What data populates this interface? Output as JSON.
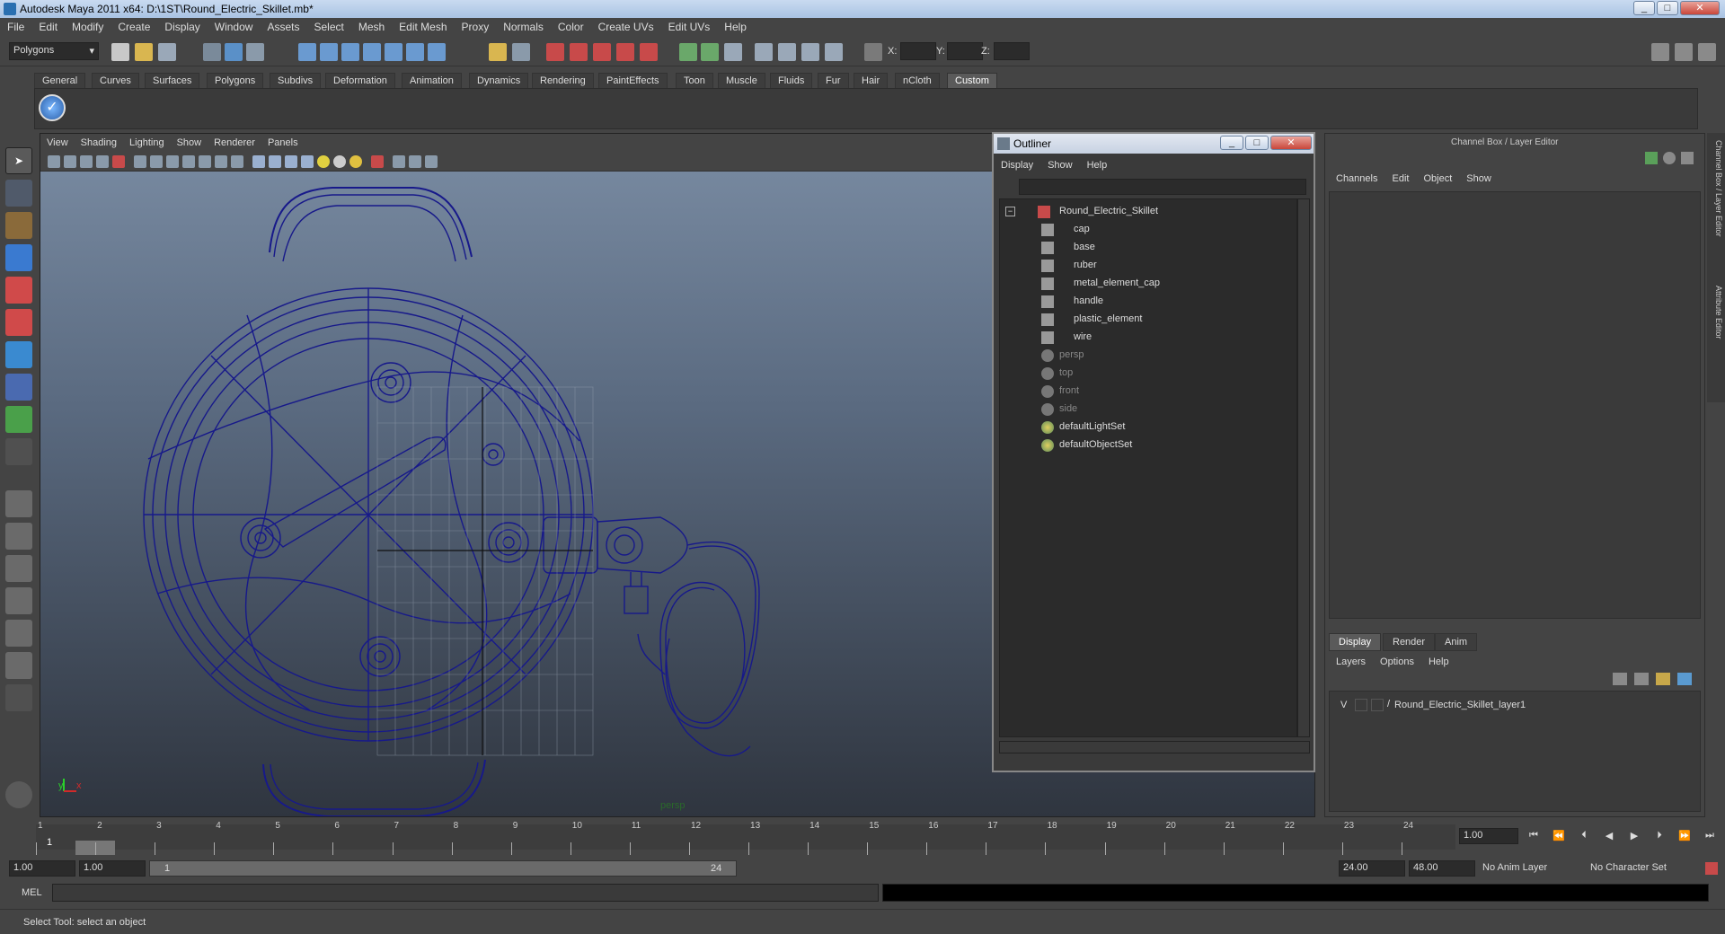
{
  "window": {
    "title": "Autodesk Maya 2011 x64: D:\\1ST\\Round_Electric_Skillet.mb*"
  },
  "menubar": [
    "File",
    "Edit",
    "Modify",
    "Create",
    "Display",
    "Window",
    "Assets",
    "Select",
    "Mesh",
    "Edit Mesh",
    "Proxy",
    "Normals",
    "Color",
    "Create UVs",
    "Edit UVs",
    "Help"
  ],
  "statusline": {
    "mode": "Polygons",
    "x_label": "X:",
    "y_label": "Y:",
    "z_label": "Z:"
  },
  "shelf_tabs": [
    "General",
    "Curves",
    "Surfaces",
    "Polygons",
    "Subdivs",
    "Deformation",
    "Animation",
    "Dynamics",
    "Rendering",
    "PaintEffects",
    "Toon",
    "Muscle",
    "Fluids",
    "Fur",
    "Hair",
    "nCloth",
    "Custom"
  ],
  "shelf_active": "Custom",
  "viewport": {
    "menu": [
      "View",
      "Shading",
      "Lighting",
      "Show",
      "Renderer",
      "Panels"
    ],
    "camera_label": "persp",
    "axis_x": "x",
    "axis_y": "y"
  },
  "outliner": {
    "title": "Outliner",
    "menu": [
      "Display",
      "Show",
      "Help"
    ],
    "root": "Round_Electric_Skillet",
    "children": [
      "cap",
      "base",
      "ruber",
      "metal_element_cap",
      "handle",
      "plastic_element",
      "wire"
    ],
    "cameras": [
      "persp",
      "top",
      "front",
      "side"
    ],
    "sets": [
      "defaultLightSet",
      "defaultObjectSet"
    ]
  },
  "channelbox": {
    "title": "Channel Box / Layer Editor",
    "menu": [
      "Channels",
      "Edit",
      "Object",
      "Show"
    ],
    "tabs": [
      "Display",
      "Render",
      "Anim"
    ],
    "active_tab": "Display",
    "layer_menu": [
      "Layers",
      "Options",
      "Help"
    ],
    "layer_visibility": "V",
    "layer_name": "Round_Electric_Skillet_layer1",
    "side_tabs": [
      "Channel Box / Layer Editor",
      "Attribute Editor"
    ]
  },
  "timeslider": {
    "ticks": [
      "1",
      "2",
      "3",
      "4",
      "5",
      "6",
      "7",
      "8",
      "9",
      "10",
      "11",
      "12",
      "13",
      "14",
      "15",
      "16",
      "17",
      "18",
      "19",
      "20",
      "21",
      "22",
      "23",
      "24"
    ],
    "current_frame": "1",
    "current_field": "1.00"
  },
  "rangeslider": {
    "start_time": "1.00",
    "playback_start": "1.00",
    "range_start_label": "1",
    "range_end_label": "24",
    "playback_end": "24.00",
    "end_time": "48.00",
    "anim_layer": "No Anim Layer",
    "character_set": "No Character Set"
  },
  "commandline": {
    "label": "MEL"
  },
  "helpline": {
    "text": "Select Tool: select an object"
  }
}
